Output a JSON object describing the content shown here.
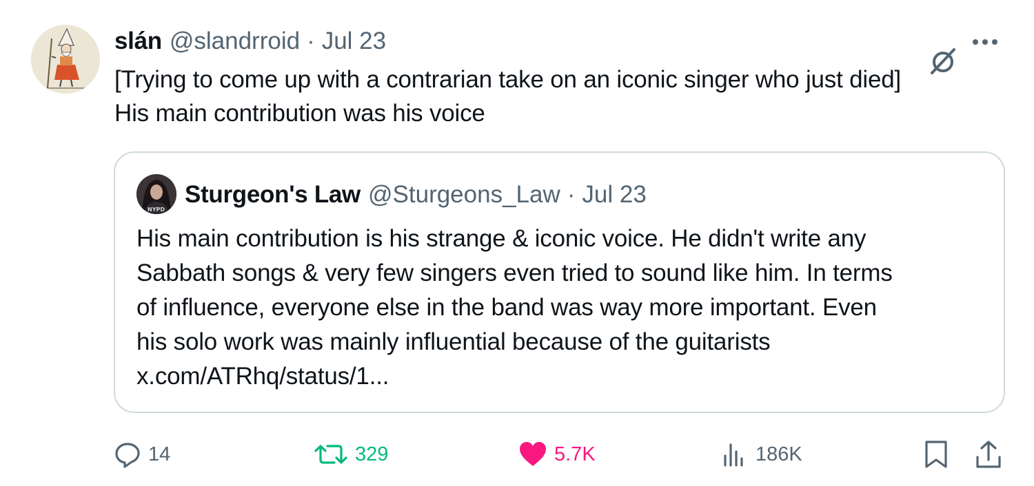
{
  "author": {
    "name": "slán",
    "handle": "@slandrroid",
    "separator": "·",
    "date": "Jul 23"
  },
  "tweet": {
    "lines": [
      "[Trying to come up with a contrarian take on an iconic singer who just died]",
      "His main contribution was his voice"
    ]
  },
  "quote": {
    "name": "Sturgeon's Law",
    "handle": "@Sturgeons_Law",
    "separator": "·",
    "date": "Jul 23",
    "avatar_shirt_text": "NYPD",
    "lines": [
      "His main contribution is his strange & iconic voice. He didn't write any",
      "Sabbath songs & very few singers even tried to sound like him. In terms",
      "of influence, everyone else in the band was way more important.  Even",
      "his solo work was mainly influential because of the guitarists",
      "x.com/ATRhq/status/1..."
    ]
  },
  "actions": {
    "replies": "14",
    "reposts": "329",
    "likes": "5.7K",
    "views": "186K"
  },
  "icons": {
    "grok": "grok-icon",
    "more": "more-icon",
    "reply": "reply-icon",
    "repost": "repost-icon",
    "like": "heart-icon",
    "views": "views-icon",
    "bookmark": "bookmark-icon",
    "share": "share-icon"
  },
  "colors": {
    "text": "#0f1419",
    "secondary": "#536471",
    "repost": "#00ba7c",
    "like": "#f91880",
    "border": "#cfd9de"
  }
}
